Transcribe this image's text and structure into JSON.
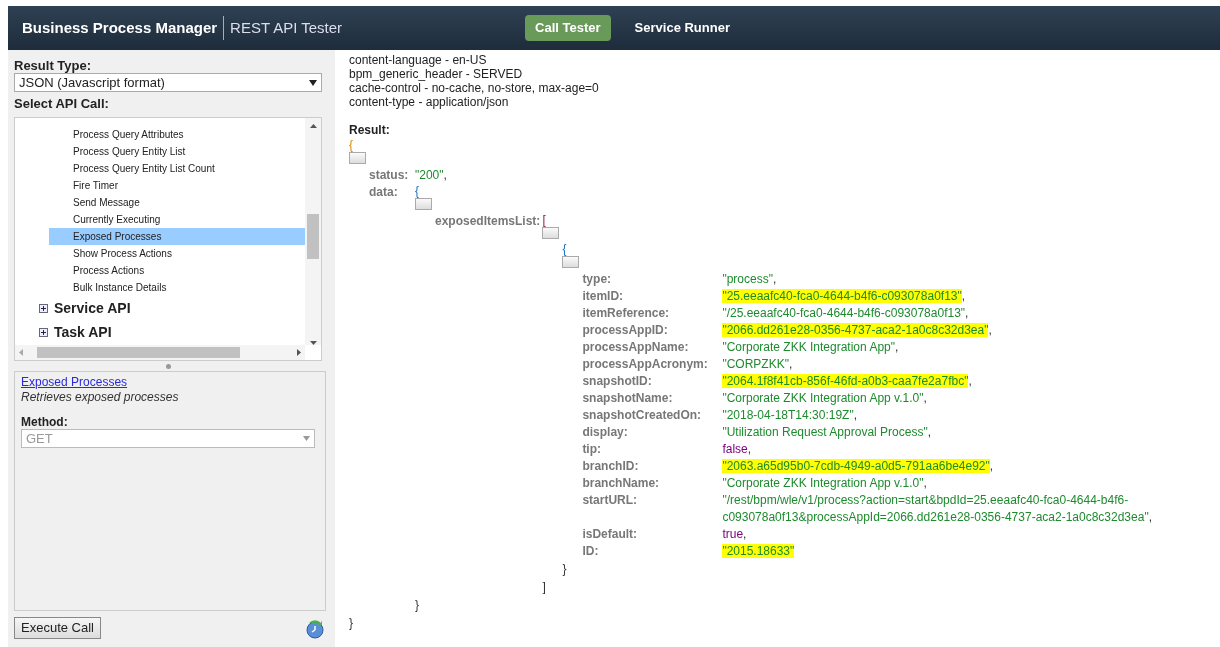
{
  "header": {
    "brand": "Business Process Manager",
    "product": "REST API Tester",
    "nav": [
      {
        "label": "Call Tester",
        "selected": true
      },
      {
        "label": "Service Runner",
        "selected": false
      }
    ]
  },
  "sidebar": {
    "result_type_label": "Result Type:",
    "result_type_value": "JSON (Javascript format)",
    "select_label": "Select API Call:",
    "api_items": [
      {
        "label": "Process Query Attributes",
        "selected": false
      },
      {
        "label": "Process Query Entity List",
        "selected": false
      },
      {
        "label": "Process Query Entity List Count",
        "selected": false
      },
      {
        "label": "Fire Timer",
        "selected": false
      },
      {
        "label": "Send Message",
        "selected": false
      },
      {
        "label": "Currently Executing",
        "selected": false
      },
      {
        "label": "Exposed Processes",
        "selected": true
      },
      {
        "label": "Show Process Actions",
        "selected": false
      },
      {
        "label": "Process Actions",
        "selected": false
      },
      {
        "label": "Bulk Instance Details",
        "selected": false
      }
    ],
    "api_groups": [
      {
        "label": "Service API",
        "expanded": false
      },
      {
        "label": "Task API",
        "expanded": false
      }
    ],
    "detail": {
      "link": "Exposed Processes",
      "description": "Retrieves exposed processes",
      "method_label": "Method:",
      "method_value": "GET"
    },
    "execute_button": "Execute Call"
  },
  "response": {
    "headers": [
      "content-language - en-US",
      "bpm_generic_header - SERVED",
      "cache-control - no-cache, no-store, max-age=0",
      "content-type - application/json"
    ],
    "result_label": "Result:",
    "result": {
      "open": "{",
      "close": "}",
      "entries": [
        {
          "key": "status:",
          "kind": "string",
          "value": "\"200\"",
          "suffix": ",",
          "highlight": false
        },
        {
          "key": "data:",
          "kind": "object",
          "open": "{",
          "close": "}",
          "entries": [
            {
              "key": "exposedItemsList:",
              "kind": "array",
              "open": "[",
              "close": "]",
              "entries": [
                {
                  "kind": "object",
                  "open": "{",
                  "close": "}",
                  "entries": [
                    {
                      "key": "type:",
                      "kind": "string",
                      "value": "\"process\"",
                      "suffix": ",",
                      "highlight": false
                    },
                    {
                      "key": "itemID:",
                      "kind": "string",
                      "value": "\"25.eeaafc40-fca0-4644-b4f6-c093078a0f13\"",
                      "suffix": ",",
                      "highlight": true
                    },
                    {
                      "key": "itemReference:",
                      "kind": "string",
                      "value": "\"/25.eeaafc40-fca0-4644-b4f6-c093078a0f13\"",
                      "suffix": ",",
                      "highlight": false
                    },
                    {
                      "key": "processAppID:",
                      "kind": "string",
                      "value": "\"2066.dd261e28-0356-4737-aca2-1a0c8c32d3ea\"",
                      "suffix": ",",
                      "highlight": true
                    },
                    {
                      "key": "processAppName:",
                      "kind": "string",
                      "value": "\"Corporate ZKK Integration App\"",
                      "suffix": ",",
                      "highlight": false
                    },
                    {
                      "key": "processAppAcronym:",
                      "kind": "string",
                      "value": "\"CORPZKK\"",
                      "suffix": ",",
                      "highlight": false
                    },
                    {
                      "key": "snapshotID:",
                      "kind": "string",
                      "value": "\"2064.1f8f41cb-856f-46fd-a0b3-caa7fe2a7fbc\"",
                      "suffix": ",",
                      "highlight": true
                    },
                    {
                      "key": "snapshotName:",
                      "kind": "string",
                      "value": "\"Corporate ZKK Integration App v.1.0\"",
                      "suffix": ",",
                      "highlight": false
                    },
                    {
                      "key": "snapshotCreatedOn:",
                      "kind": "string",
                      "value": "\"2018-04-18T14:30:19Z\"",
                      "suffix": ",",
                      "highlight": false
                    },
                    {
                      "key": "display:",
                      "kind": "string",
                      "value": "\"Utilization Request Approval Process\"",
                      "suffix": ",",
                      "highlight": false
                    },
                    {
                      "key": "tip:",
                      "kind": "boolean",
                      "value": "false",
                      "suffix": ",",
                      "highlight": false
                    },
                    {
                      "key": "branchID:",
                      "kind": "string",
                      "value": "\"2063.a65d95b0-7cdb-4949-a0d5-791aa6be4e92\"",
                      "suffix": ",",
                      "highlight": true
                    },
                    {
                      "key": "branchName:",
                      "kind": "string",
                      "value": "\"Corporate ZKK Integration App v.1.0\"",
                      "suffix": ",",
                      "highlight": false
                    },
                    {
                      "key": "startURL:",
                      "kind": "string",
                      "value": "\"/rest/bpm/wle/v1/process?action=start&bpdId=25.eeaafc40-fca0-4644-b4f6-c093078a0f13&processAppId=2066.dd261e28-0356-4737-aca2-1a0c8c32d3ea\"",
                      "suffix": ",",
                      "highlight": false
                    },
                    {
                      "key": "isDefault:",
                      "kind": "boolean",
                      "value": "true",
                      "suffix": ",",
                      "highlight": false
                    },
                    {
                      "key": "ID:",
                      "kind": "string",
                      "value": "\"2015.18633\"",
                      "highlight": true
                    }
                  ]
                }
              ]
            }
          ]
        }
      ]
    }
  }
}
